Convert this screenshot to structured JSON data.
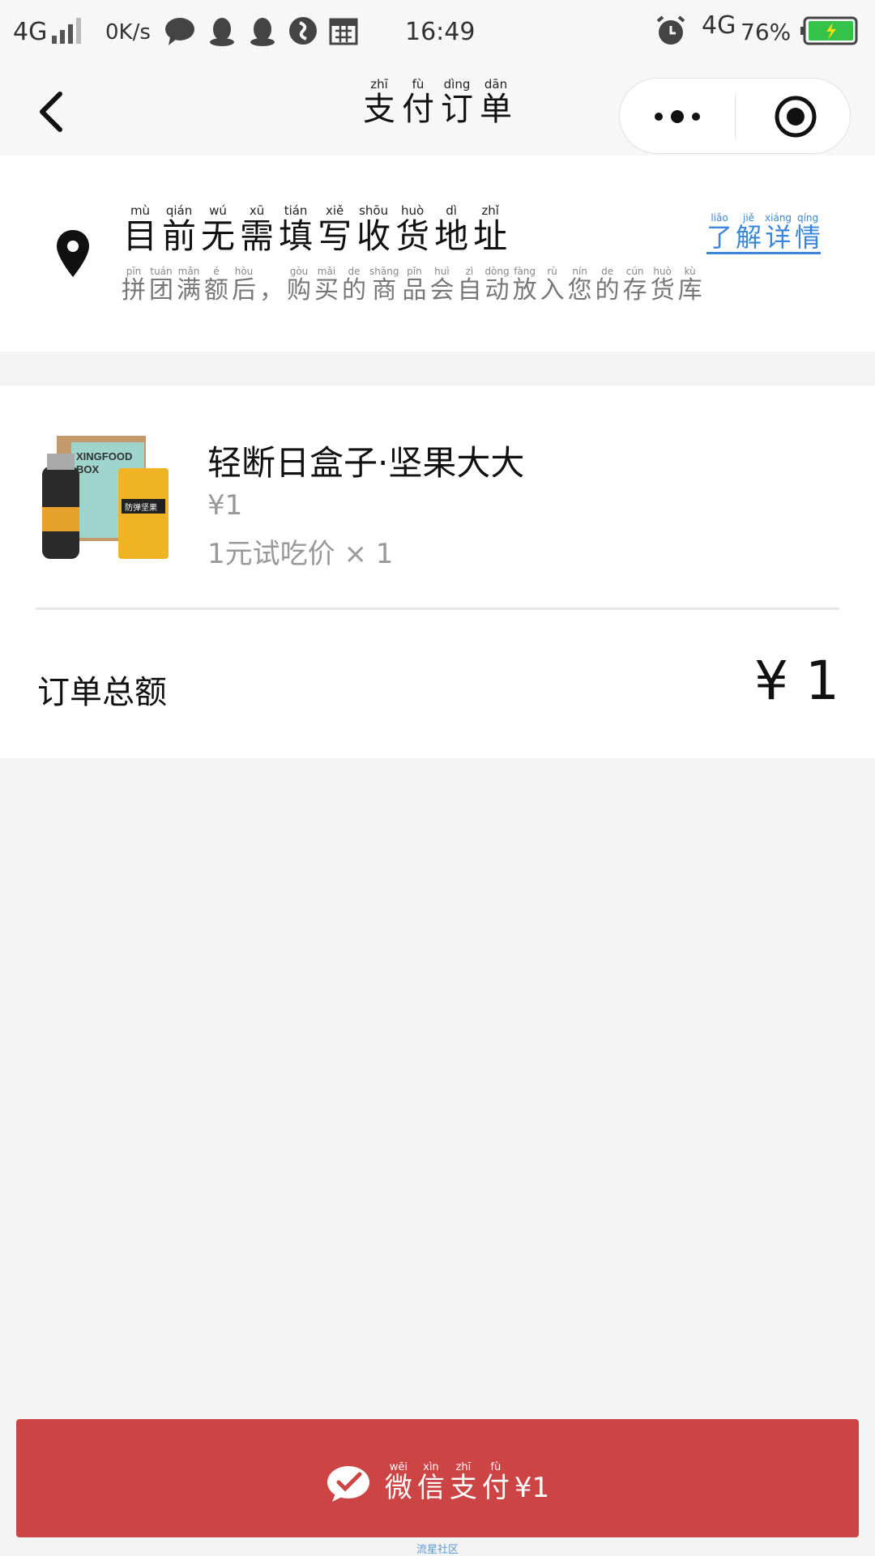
{
  "status_bar": {
    "network": "4G",
    "speed": "0K/s",
    "time": "16:49",
    "network_right": "4G",
    "battery": "76%",
    "icons": [
      "signal-icon",
      "chat-icon",
      "qq-icon",
      "qq-icon",
      "music-icon",
      "calendar-icon",
      "alarm-icon",
      "battery-icon"
    ]
  },
  "nav": {
    "title": [
      {
        "py": "zhī",
        "ch": "支"
      },
      {
        "py": "fù",
        "ch": "付"
      },
      {
        "py": "dìng",
        "ch": "订"
      },
      {
        "py": "dān",
        "ch": "单"
      }
    ]
  },
  "address": {
    "title": [
      {
        "py": "mù",
        "ch": "目"
      },
      {
        "py": "qián",
        "ch": "前"
      },
      {
        "py": "wú",
        "ch": "无"
      },
      {
        "py": "xū",
        "ch": "需"
      },
      {
        "py": "tián",
        "ch": "填"
      },
      {
        "py": "xiě",
        "ch": "写"
      },
      {
        "py": "shōu",
        "ch": "收"
      },
      {
        "py": "huò",
        "ch": "货"
      },
      {
        "py": "dì",
        "ch": "地"
      },
      {
        "py": "zhǐ",
        "ch": "址"
      }
    ],
    "subtitle": [
      {
        "py": "pīn",
        "ch": "拼"
      },
      {
        "py": "tuán",
        "ch": "团"
      },
      {
        "py": "mǎn",
        "ch": "满"
      },
      {
        "py": "é",
        "ch": "额"
      },
      {
        "py": "hòu",
        "ch": "后"
      },
      {
        "py": "",
        "ch": "，"
      },
      {
        "py": "gòu",
        "ch": "购"
      },
      {
        "py": "mǎi",
        "ch": "买"
      },
      {
        "py": "de",
        "ch": "的"
      },
      {
        "py": "shāng",
        "ch": "商"
      },
      {
        "py": "pǐn",
        "ch": "品"
      },
      {
        "py": "huì",
        "ch": "会"
      },
      {
        "py": "zì",
        "ch": "自"
      },
      {
        "py": "dòng",
        "ch": "动"
      },
      {
        "py": "fàng",
        "ch": "放"
      },
      {
        "py": "rù",
        "ch": "入"
      },
      {
        "py": "nín",
        "ch": "您"
      },
      {
        "py": "de",
        "ch": "的"
      },
      {
        "py": "cún",
        "ch": "存"
      },
      {
        "py": "huò",
        "ch": "货"
      },
      {
        "py": "kù",
        "ch": "库"
      }
    ],
    "link": [
      {
        "py": "liǎo",
        "ch": "了"
      },
      {
        "py": "jiě",
        "ch": "解"
      },
      {
        "py": "xiáng",
        "ch": "详"
      },
      {
        "py": "qíng",
        "ch": "情"
      }
    ]
  },
  "order": {
    "product_name": "轻断日盒子·坚果大大",
    "price": "¥1",
    "spec": "1元试吃价 × 1",
    "product_image_text": [
      "XINGFOOD",
      "BOX",
      "防弹坚果"
    ],
    "total_label": "订单总额",
    "total_amount": "¥ 1"
  },
  "pay_button": {
    "label": [
      {
        "py": "wēi",
        "ch": "微"
      },
      {
        "py": "xìn",
        "ch": "信"
      },
      {
        "py": "zhī",
        "ch": "支"
      },
      {
        "py": "fù",
        "ch": "付"
      },
      {
        "py": "",
        "ch": "¥1"
      }
    ]
  },
  "watermark": "流星社区",
  "colors": {
    "pay_red": "#cc4444",
    "link_blue": "#3a86d8",
    "page_bg": "#f4f4f4"
  }
}
